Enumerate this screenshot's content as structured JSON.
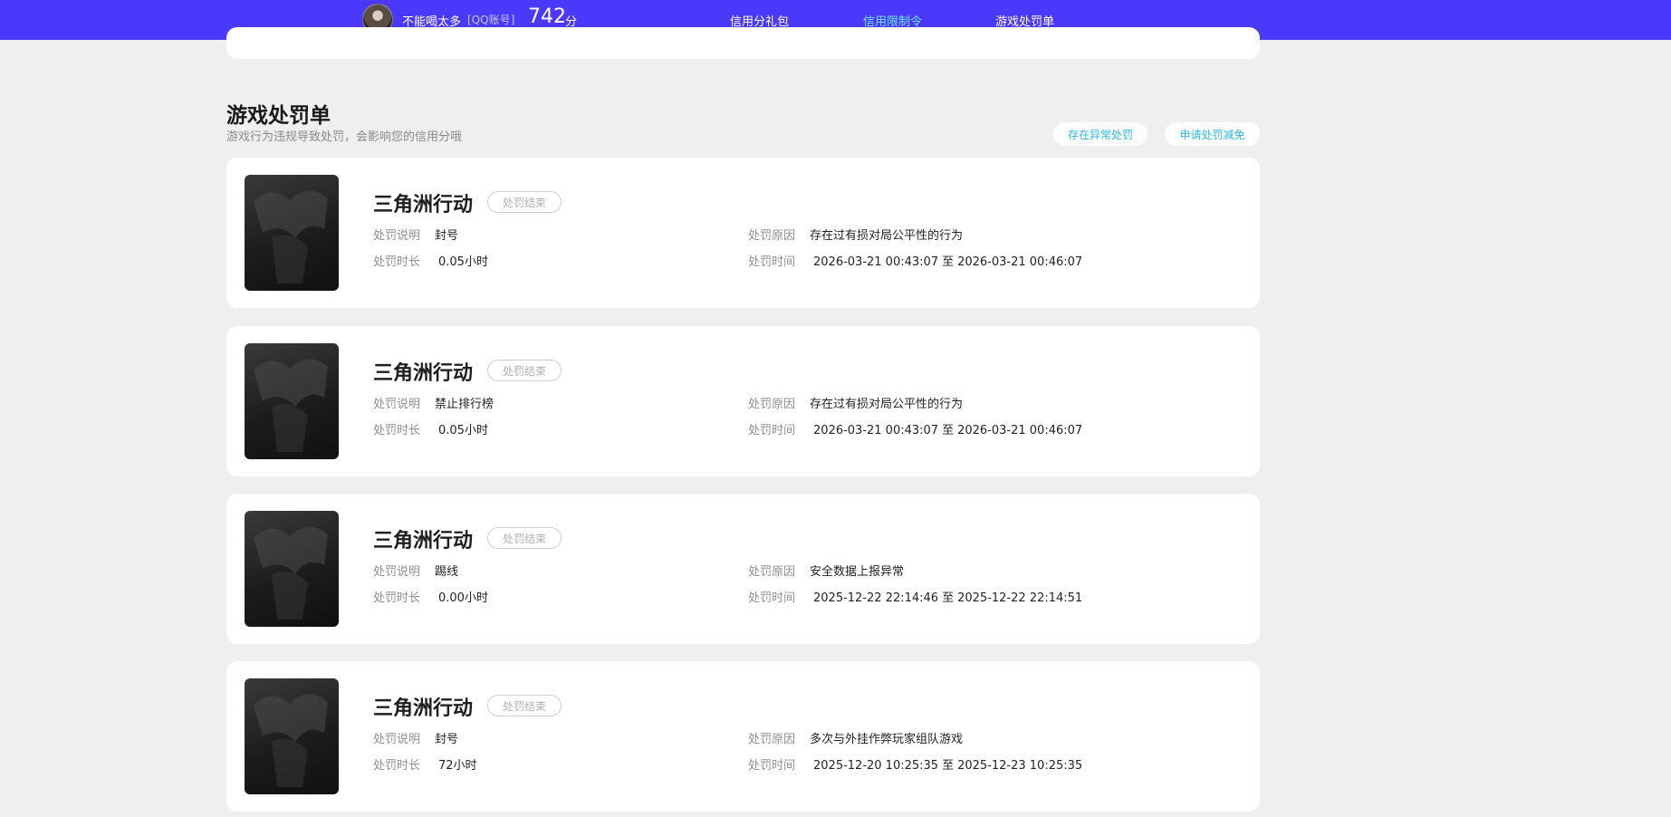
{
  "header": {
    "username": "不能喝太多",
    "account_type": "[QQ账号]",
    "score": "742",
    "score_unit": "分",
    "tabs": [
      {
        "label": "信用分礼包",
        "active": false
      },
      {
        "label": "信用限制令",
        "active": true
      },
      {
        "label": "游戏处罚单",
        "active": false
      }
    ],
    "accent_color": "#4a38fb",
    "active_color": "#6ee7ff"
  },
  "section": {
    "title": "游戏处罚单",
    "subtitle": "游戏行为违规导致处罚，会影响您的信用分哦",
    "buttons": {
      "abnormal": "存在异常处罚",
      "appeal": "申请处罚减免"
    }
  },
  "labels": {
    "desc": "处罚说明",
    "duration": "处罚时长",
    "reason": "处罚原因",
    "time": "处罚时间",
    "time_sep": "至"
  },
  "penalties": [
    {
      "game": "三角洲行动",
      "status": "处罚结束",
      "desc": "封号",
      "duration": "0.05小时",
      "reason": "存在过有损对局公平性的行为",
      "start": "2026-03-21 00:43:07",
      "end": "2026-03-21 00:46:07"
    },
    {
      "game": "三角洲行动",
      "status": "处罚结束",
      "desc": "禁止排行榜",
      "duration": "0.05小时",
      "reason": "存在过有损对局公平性的行为",
      "start": "2026-03-21 00:43:07",
      "end": "2026-03-21 00:46:07"
    },
    {
      "game": "三角洲行动",
      "status": "处罚结束",
      "desc": "踢线",
      "duration": "0.00小时",
      "reason": "安全数据上报异常",
      "start": "2025-12-22 22:14:46",
      "end": "2025-12-22 22:14:51"
    },
    {
      "game": "三角洲行动",
      "status": "处罚结束",
      "desc": "封号",
      "duration": "72小时",
      "reason": "多次与外挂作弊玩家组队游戏",
      "start": "2025-12-20 10:25:35",
      "end": "2025-12-23 10:25:35"
    }
  ]
}
